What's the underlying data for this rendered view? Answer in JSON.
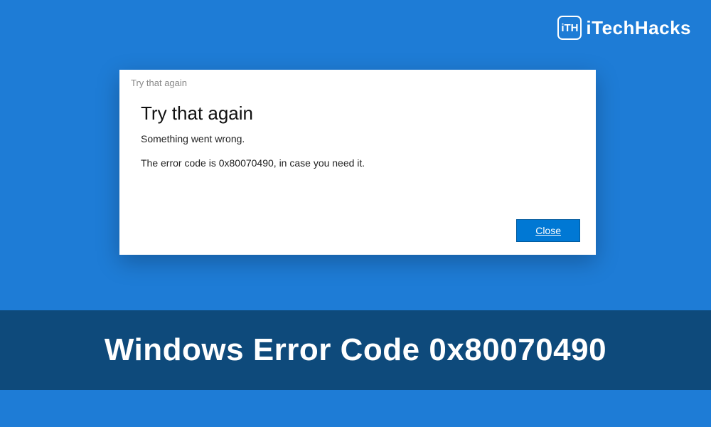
{
  "brand": {
    "logo_text": "iTH",
    "name": "iTechHacks"
  },
  "dialog": {
    "window_title": "Try that again",
    "heading": "Try that again",
    "subtext": "Something went wrong.",
    "detail": "The error code is 0x80070490, in case you need it.",
    "close_label": "Close"
  },
  "banner": {
    "text": "Windows Error Code 0x80070490"
  }
}
